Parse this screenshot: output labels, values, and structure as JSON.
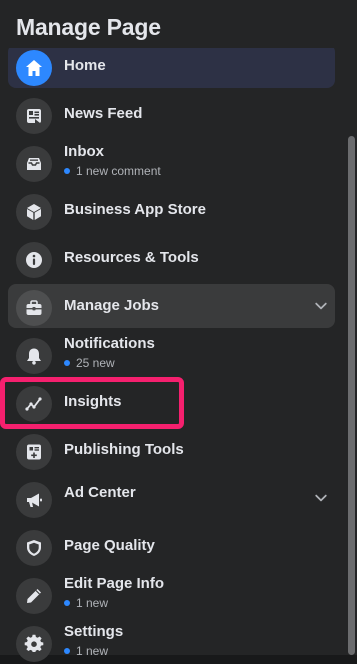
{
  "panel_title": "Manage Page",
  "items": [
    {
      "label": "Home"
    },
    {
      "label": "News Feed"
    },
    {
      "label": "Inbox",
      "sub": "1 new comment"
    },
    {
      "label": "Business App Store"
    },
    {
      "label": "Resources & Tools"
    },
    {
      "label": "Manage Jobs"
    },
    {
      "label": "Notifications",
      "sub": "25 new"
    },
    {
      "label": "Insights"
    },
    {
      "label": "Publishing Tools"
    },
    {
      "label": "Ad Center"
    },
    {
      "label": "Page Quality"
    },
    {
      "label": "Edit Page Info",
      "sub": "1 new"
    },
    {
      "label": "Settings",
      "sub": "1 new"
    }
  ],
  "colors": {
    "accent": "#2d88ff",
    "highlight": "#f5206e",
    "active_row": "#2d3145"
  }
}
